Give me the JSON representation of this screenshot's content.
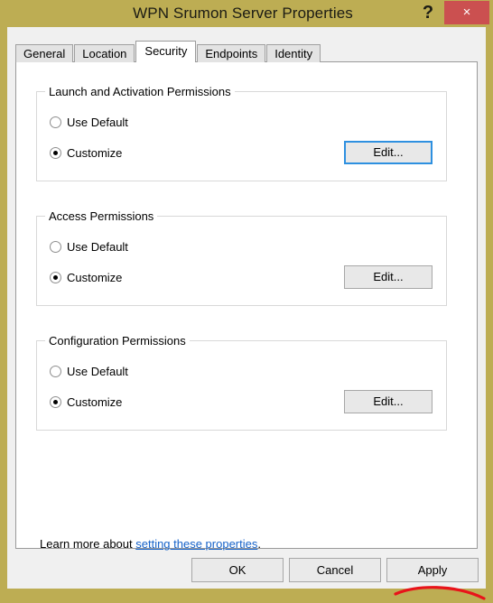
{
  "window": {
    "title": "WPN Srumon Server Properties",
    "titlebar_color": "#bdad53",
    "help_icon": "?",
    "close_icon": "×",
    "close_button_color": "#cb5050"
  },
  "tabs": [
    {
      "label": "General",
      "active": false
    },
    {
      "label": "Location",
      "active": false
    },
    {
      "label": "Security",
      "active": true
    },
    {
      "label": "Endpoints",
      "active": false
    },
    {
      "label": "Identity",
      "active": false
    }
  ],
  "groups": [
    {
      "title": "Launch and Activation Permissions",
      "options": [
        {
          "label": "Use Default",
          "selected": false
        },
        {
          "label": "Customize",
          "selected": true
        }
      ],
      "edit_label": "Edit...",
      "edit_focused": true
    },
    {
      "title": "Access Permissions",
      "options": [
        {
          "label": "Use Default",
          "selected": false
        },
        {
          "label": "Customize",
          "selected": true
        }
      ],
      "edit_label": "Edit...",
      "edit_focused": false
    },
    {
      "title": "Configuration Permissions",
      "options": [
        {
          "label": "Use Default",
          "selected": false
        },
        {
          "label": "Customize",
          "selected": true
        }
      ],
      "edit_label": "Edit...",
      "edit_focused": false
    }
  ],
  "learn_more": {
    "prefix": "Learn more about ",
    "link_text": "setting these properties",
    "suffix": ".",
    "link_color": "#1763c9"
  },
  "footer": {
    "ok_label": "OK",
    "cancel_label": "Cancel",
    "apply_label": "Apply"
  },
  "annotation": {
    "shape": "red-underline-curve",
    "color": "#e8131a",
    "target": "Apply"
  }
}
